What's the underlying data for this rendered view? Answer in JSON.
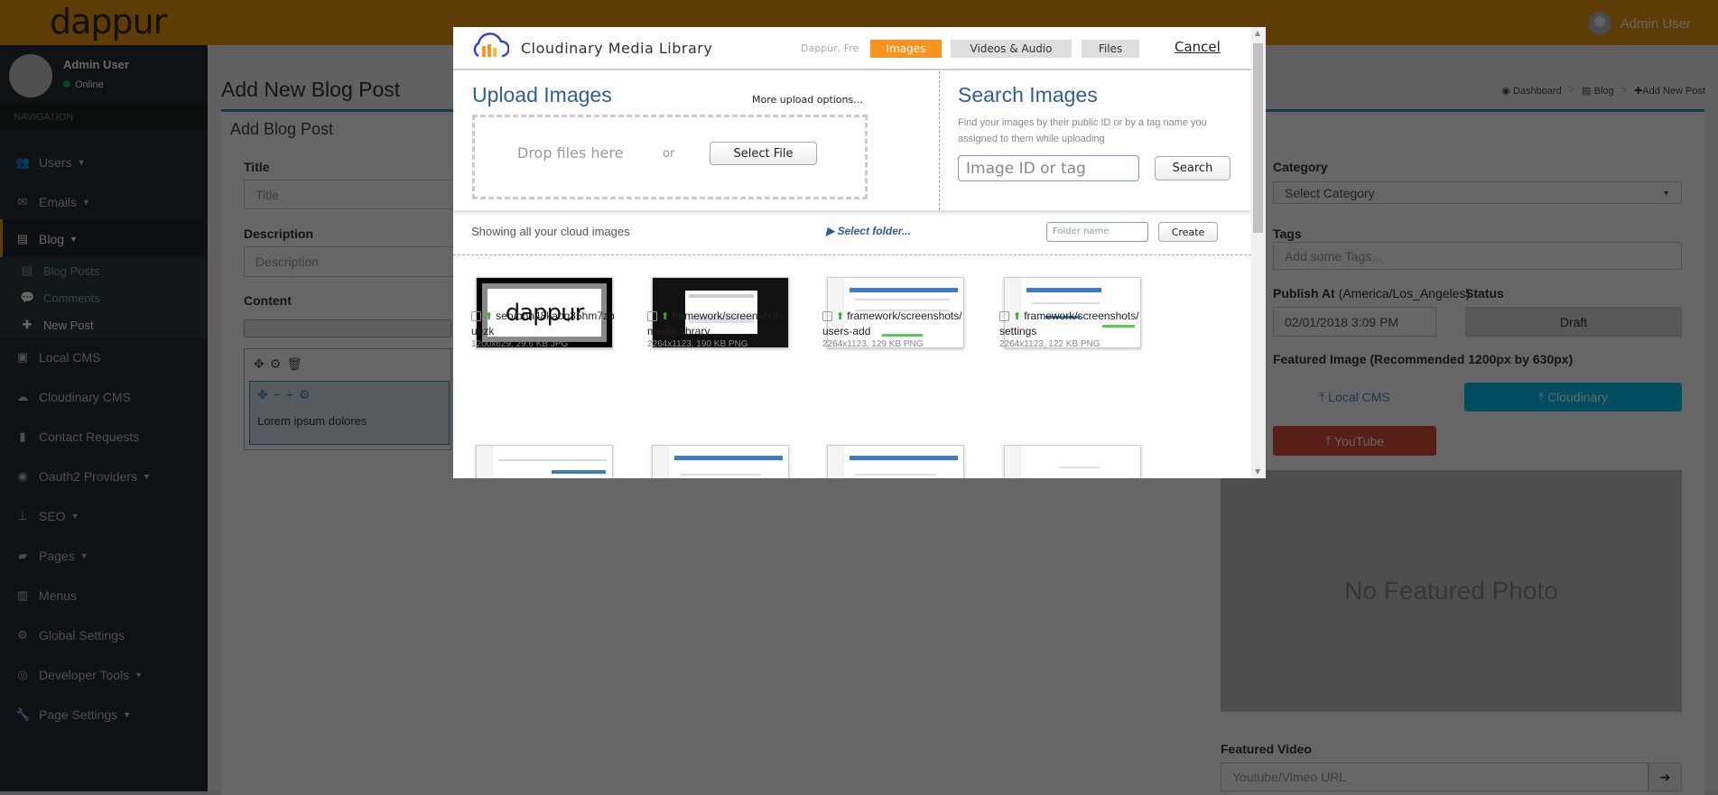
{
  "topbar": {
    "logo": "dappur",
    "user": "Admin User"
  },
  "sidebar": {
    "user_name": "Admin User",
    "status": "Online",
    "nav_header": "NAVIGATION",
    "items": [
      {
        "label": "Users",
        "icon": "users-icon",
        "caret": true
      },
      {
        "label": "Emails",
        "icon": "envelope-icon",
        "caret": true
      },
      {
        "label": "Blog",
        "icon": "newspaper-icon",
        "caret": true,
        "active": true
      },
      {
        "label": "Blog Posts",
        "icon": "newspaper-icon",
        "sub": true
      },
      {
        "label": "Comments",
        "icon": "comment-icon",
        "sub": true
      },
      {
        "label": "New Post",
        "icon": "plus-icon",
        "sub": true,
        "current": true
      },
      {
        "label": "Local CMS",
        "icon": "image-icon"
      },
      {
        "label": "Cloudinary CMS",
        "icon": "cloud-icon"
      },
      {
        "label": "Contact Requests",
        "icon": "contact-icon"
      },
      {
        "label": "Oauth2 Providers",
        "icon": "user-circle-icon",
        "caret": true
      },
      {
        "label": "SEO",
        "icon": "sitemap-icon",
        "caret": true
      },
      {
        "label": "Pages",
        "icon": "book-icon",
        "caret": true
      },
      {
        "label": "Menus",
        "icon": "map-icon"
      },
      {
        "label": "Global Settings",
        "icon": "cogs-icon"
      },
      {
        "label": "Developer Tools",
        "icon": "life-ring-icon",
        "caret": true
      },
      {
        "label": "Page Settings",
        "icon": "wrench-icon",
        "caret": true
      }
    ]
  },
  "page": {
    "title": "Add New Blog Post",
    "breadcrumbs": [
      "Dashboard",
      "Blog",
      "Add New Post"
    ],
    "box_title": "Add Blog Post",
    "title_label": "Title",
    "title_placeholder": "Title",
    "description_label": "Description",
    "description_placeholder": "Description",
    "content_label": "Content",
    "content_text": "Lorem ipsum dolores",
    "category_label": "Category",
    "category_value": "Select Category",
    "tags_label": "Tags",
    "tags_placeholder": "Add some Tags...",
    "publish_label": "Publish At",
    "publish_tz": "(America/Los_Angeles)",
    "publish_value": "02/01/2018 3:09 PM",
    "status_label": "Status",
    "status_value": "Draft",
    "featured_label": "Featured Image (Recommended 1200px by 630px)",
    "btn_local": "Local CMS",
    "btn_cloudinary": "Cloudinary",
    "btn_youtube": "YouTube",
    "no_photo": "No Featured Photo",
    "video_label": "Featured Video",
    "video_placeholder": "Youtube/Vimeo URL"
  },
  "colors": {
    "topbar": "#e8960f",
    "sidebar": "#222d32",
    "cloudinary": "#00c0ef",
    "youtube": "#dd4b39",
    "tab_active": "#f7941d"
  },
  "modal": {
    "title": "Cloudinary Media Library",
    "account": "Dappur, Fre",
    "tabs": [
      "Images",
      "Videos & Audio",
      "Files"
    ],
    "cancel": "Cancel",
    "upload_heading": "Upload Images",
    "more_options": "More upload options...",
    "drop_text": "Drop files here",
    "or": "or",
    "select_file": "Select File",
    "search_heading": "Search Images",
    "search_desc": "Find your images by their public ID or by a tag name you assigned to them while uploading",
    "search_placeholder": "Image ID or tag",
    "search_btn": "Search",
    "showing": "Showing all your cloud images",
    "select_folder": "Select folder...",
    "folder_placeholder": "Folder name",
    "create": "Create",
    "images": [
      {
        "name": "seo/bbn48kaoq35hm7zbuuzk",
        "meta": "1200x629, 29.6 KB JPG"
      },
      {
        "name": "framework/screenshots/media-library",
        "meta": "2264x1123, 190 KB PNG"
      },
      {
        "name": "framework/screenshots/users-add",
        "meta": "2264x1123, 129 KB PNG"
      },
      {
        "name": "framework/screenshots/settings",
        "meta": "2264x1123, 122 KB PNG"
      }
    ]
  }
}
